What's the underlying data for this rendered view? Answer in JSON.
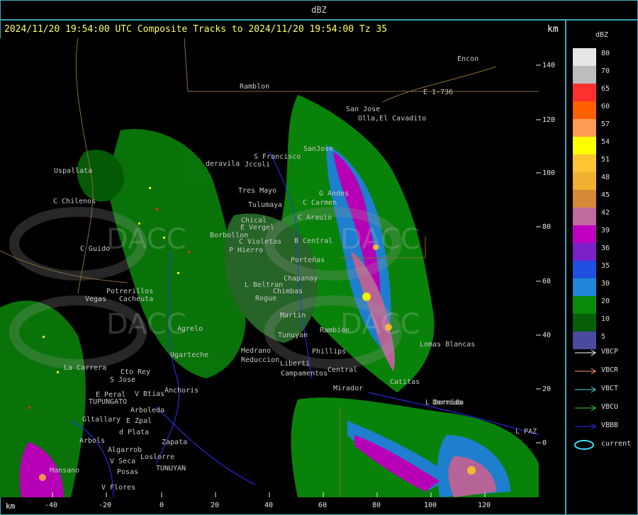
{
  "product": "dBZ",
  "header": "2024/11/20 19:54:00 UTC Composite Tracks to 2024/11/20 19:54:00 Tz 35",
  "km_label": "km",
  "legend": {
    "title": "dBZ",
    "entries": [
      {
        "label": "80",
        "color": "#e6e6e6"
      },
      {
        "label": "70",
        "color": "#bdbdbd"
      },
      {
        "label": "65",
        "color": "#ff3030"
      },
      {
        "label": "60",
        "color": "#ff6000"
      },
      {
        "label": "57",
        "color": "#ff9a55"
      },
      {
        "label": "54",
        "color": "#ffff00"
      },
      {
        "label": "51",
        "color": "#ffc533"
      },
      {
        "label": "48",
        "color": "#f0b030"
      },
      {
        "label": "45",
        "color": "#d58a3a"
      },
      {
        "label": "42",
        "color": "#c06aa0"
      },
      {
        "label": "39",
        "color": "#c000c0"
      },
      {
        "label": "36",
        "color": "#7a22c8"
      },
      {
        "label": "35",
        "color": "#2050e0"
      },
      {
        "label": "30",
        "color": "#1f86d8"
      },
      {
        "label": "20",
        "color": "#0a8a0a"
      },
      {
        "label": "10",
        "color": "#065e06"
      },
      {
        "label": "5",
        "color": "#4a4aa0"
      }
    ]
  },
  "tracks": [
    {
      "label": "VBCP",
      "color": "#ffffff"
    },
    {
      "label": "VBCR",
      "color": "#ff9a70"
    },
    {
      "label": "VBCT",
      "color": "#40e0e0"
    },
    {
      "label": "VBCU",
      "color": "#40d040"
    },
    {
      "label": "VBBB",
      "color": "#3030ff"
    },
    {
      "label": "current",
      "color": "#40e0ff"
    }
  ],
  "y_axis": [
    "140",
    "120",
    "100",
    "80",
    "60",
    "40",
    "20",
    "0"
  ],
  "x_axis": [
    "-40",
    "-20",
    "0",
    "20",
    "40",
    "60",
    "80",
    "100",
    "120"
  ],
  "places": [
    "Ramblon",
    "Encon",
    "E 1-736",
    "San Jose",
    "Olla,El Cavadito",
    "SanJose",
    "Uspallata",
    "S Francisco",
    "Jccoli",
    "Tres Mayo",
    "Tulumaya",
    "C Chilenos",
    "G Andes",
    "C Carmen",
    "Chical",
    "E Vergel",
    "C Arauio",
    "C Guido",
    "Borbollon",
    "C Violetas",
    "B Central",
    "P Hierro",
    "Porteñas",
    "Chapanay",
    "Potrerillos",
    "Vegas",
    "Cacheuta",
    "L Beltran",
    "Chimbas",
    "Rogue",
    "Martin",
    "Rambion",
    "Tunuyan",
    "Agrelo",
    "Ugarteche",
    "Medrano",
    "Phillips",
    "Lomas Blancas",
    "La Carrera",
    "Cto Rey",
    "S Jose",
    "Anchoris",
    "Central",
    "Campamentos",
    "Mirador",
    "Catitas",
    "E Peral",
    "V Btias",
    "TUPUNGATO",
    "Arboleda",
    "Gltallary",
    "E Zpal",
    "d Plata",
    "Zapata",
    "Arbols",
    "Algarrob",
    "V Seca",
    "Loslorre",
    "Posas",
    "TUNUYAN",
    "V Flores",
    "Dorrida",
    "L PAZ",
    "Mansano",
    "Liberti",
    "deravila",
    "Reduccion",
    "L Dormida"
  ],
  "watermark": "DACC"
}
